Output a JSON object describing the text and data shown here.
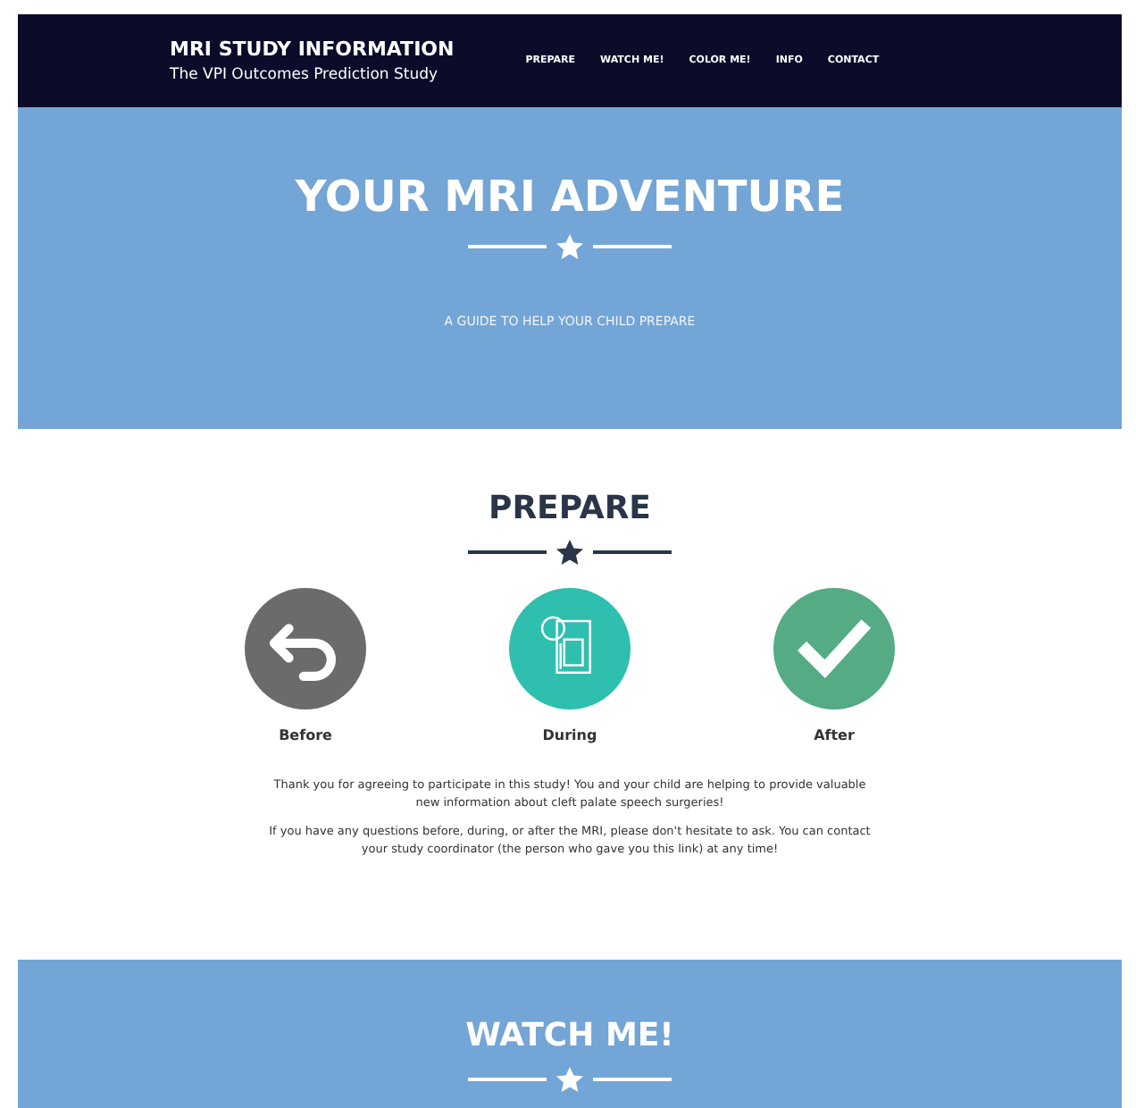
{
  "header": {
    "title": "MRI STUDY INFORMATION",
    "subtitle": "The VPI Outcomes Prediction Study",
    "nav": [
      "PREPARE",
      "WATCH ME!",
      "COLOR ME!",
      "INFO",
      "CONTACT"
    ]
  },
  "hero": {
    "title": "YOUR MRI ADVENTURE",
    "tagline": "A GUIDE TO HELP YOUR CHILD PREPARE"
  },
  "prepare": {
    "title": "PREPARE",
    "steps": [
      {
        "kind": "back",
        "label": "Before",
        "color": "#6b6b6b"
      },
      {
        "kind": "document",
        "label": "During",
        "color": "#2fbfae"
      },
      {
        "kind": "check",
        "label": "After",
        "color": "#55ab84"
      }
    ],
    "paragraphs": [
      "Thank you for agreeing to participate in this study! You and your child are helping to provide valuable new information about cleft palate speech surgeries!",
      "If you have any questions before, during, or after the MRI, please don't hesitate to ask. You can contact your study coordinator (the person who gave you this link) at any time!"
    ]
  },
  "watch": {
    "title": "WATCH ME!"
  }
}
